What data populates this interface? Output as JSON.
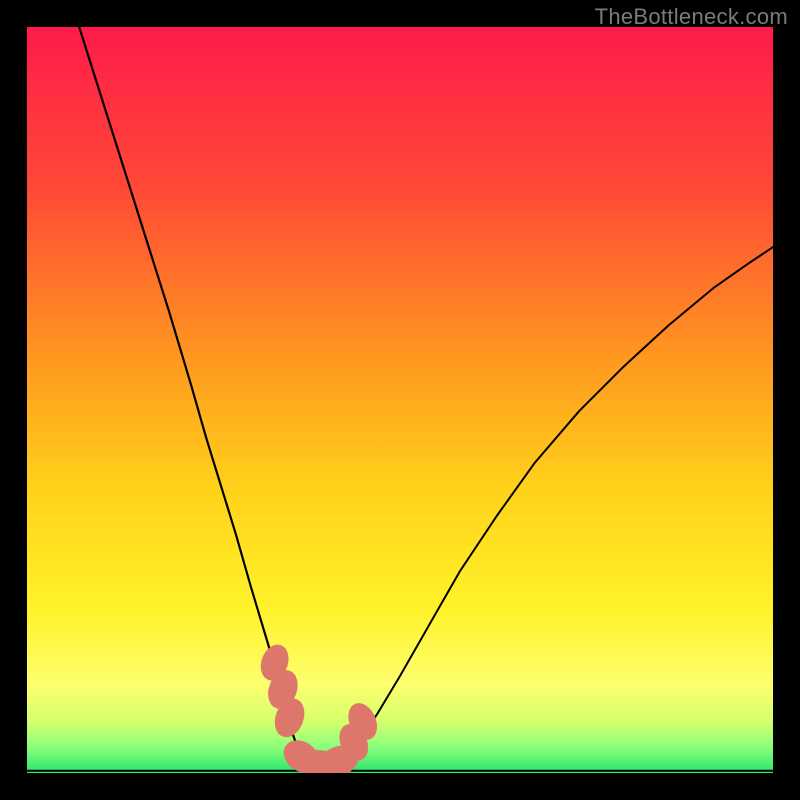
{
  "watermark": "TheBottleneck.com",
  "chart_data": {
    "type": "line",
    "title": "",
    "subtitle": "",
    "xlabel": "",
    "ylabel": "",
    "xlim": [
      0,
      100
    ],
    "ylim": [
      0,
      100
    ],
    "grid": false,
    "legend": false,
    "background_gradient": {
      "stops": [
        {
          "offset": 0.0,
          "color": "#ff1a4b"
        },
        {
          "offset": 0.22,
          "color": "#ff4a36"
        },
        {
          "offset": 0.45,
          "color": "#ff9a1f"
        },
        {
          "offset": 0.62,
          "color": "#ffd21a"
        },
        {
          "offset": 0.78,
          "color": "#fff22a"
        },
        {
          "offset": 0.88,
          "color": "#fdff6e"
        },
        {
          "offset": 0.93,
          "color": "#d8ff6e"
        },
        {
          "offset": 0.965,
          "color": "#8cff7a"
        },
        {
          "offset": 1.0,
          "color": "#28e56e"
        }
      ]
    },
    "series": [
      {
        "name": "curve-left",
        "stroke": "#000000",
        "stroke_width": 2.2,
        "x": [
          7,
          10,
          13,
          16,
          19,
          22,
          24,
          26,
          28,
          30,
          31.5,
          33,
          34,
          35,
          35.7,
          36.3
        ],
        "y": [
          100,
          90.5,
          81,
          71.5,
          62,
          52,
          45,
          38.5,
          32,
          25,
          20,
          15,
          11,
          7.5,
          5,
          3.3
        ]
      },
      {
        "name": "curve-right",
        "stroke": "#000000",
        "stroke_width": 2.0,
        "x": [
          43.7,
          45,
          47,
          50,
          54,
          58,
          63,
          68,
          74,
          80,
          86,
          92,
          97,
          100
        ],
        "y": [
          3.3,
          5,
          8,
          13,
          20,
          27,
          34.5,
          41.5,
          48.5,
          54.5,
          60,
          65,
          68.5,
          70.5
        ]
      },
      {
        "name": "floor-line",
        "stroke": "#000000",
        "stroke_width": 2.0,
        "x": [
          0,
          100
        ],
        "y": [
          0.3,
          0.3
        ]
      }
    ],
    "markers": {
      "name": "salmon-blobs",
      "fill": "#de776b",
      "stroke": "#de776b",
      "points": [
        {
          "x": 33.2,
          "y": 14.8,
          "rx": 1.7,
          "ry": 2.4,
          "rot": 20
        },
        {
          "x": 34.3,
          "y": 11.2,
          "rx": 1.8,
          "ry": 2.6,
          "rot": 20
        },
        {
          "x": 35.2,
          "y": 7.4,
          "rx": 1.8,
          "ry": 2.6,
          "rot": 20
        },
        {
          "x": 43.8,
          "y": 4.1,
          "rx": 1.7,
          "ry": 2.5,
          "rot": -24
        },
        {
          "x": 45.0,
          "y": 6.9,
          "rx": 1.7,
          "ry": 2.5,
          "rot": -24
        },
        {
          "x": 36.8,
          "y": 2.2,
          "rx": 2.5,
          "ry": 1.9,
          "rot": 35
        },
        {
          "x": 39.2,
          "y": 1.1,
          "rx": 2.6,
          "ry": 1.9,
          "rot": 3
        },
        {
          "x": 41.8,
          "y": 1.6,
          "rx": 2.6,
          "ry": 1.9,
          "rot": -20
        }
      ]
    }
  }
}
